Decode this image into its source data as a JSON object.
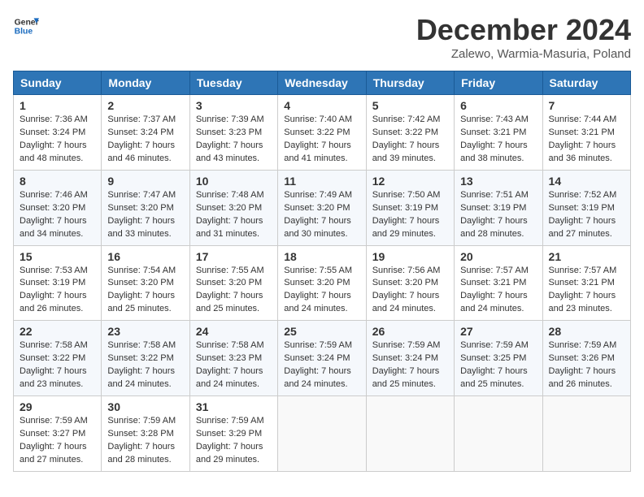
{
  "header": {
    "logo": {
      "general": "General",
      "blue": "Blue"
    },
    "title": "December 2024",
    "location": "Zalewo, Warmia-Masuria, Poland"
  },
  "weekdays": [
    "Sunday",
    "Monday",
    "Tuesday",
    "Wednesday",
    "Thursday",
    "Friday",
    "Saturday"
  ],
  "weeks": [
    [
      {
        "day": "1",
        "sunrise": "7:36 AM",
        "sunset": "3:24 PM",
        "daylight": "7 hours and 48 minutes."
      },
      {
        "day": "2",
        "sunrise": "7:37 AM",
        "sunset": "3:24 PM",
        "daylight": "7 hours and 46 minutes."
      },
      {
        "day": "3",
        "sunrise": "7:39 AM",
        "sunset": "3:23 PM",
        "daylight": "7 hours and 43 minutes."
      },
      {
        "day": "4",
        "sunrise": "7:40 AM",
        "sunset": "3:22 PM",
        "daylight": "7 hours and 41 minutes."
      },
      {
        "day": "5",
        "sunrise": "7:42 AM",
        "sunset": "3:22 PM",
        "daylight": "7 hours and 39 minutes."
      },
      {
        "day": "6",
        "sunrise": "7:43 AM",
        "sunset": "3:21 PM",
        "daylight": "7 hours and 38 minutes."
      },
      {
        "day": "7",
        "sunrise": "7:44 AM",
        "sunset": "3:21 PM",
        "daylight": "7 hours and 36 minutes."
      }
    ],
    [
      {
        "day": "8",
        "sunrise": "7:46 AM",
        "sunset": "3:20 PM",
        "daylight": "7 hours and 34 minutes."
      },
      {
        "day": "9",
        "sunrise": "7:47 AM",
        "sunset": "3:20 PM",
        "daylight": "7 hours and 33 minutes."
      },
      {
        "day": "10",
        "sunrise": "7:48 AM",
        "sunset": "3:20 PM",
        "daylight": "7 hours and 31 minutes."
      },
      {
        "day": "11",
        "sunrise": "7:49 AM",
        "sunset": "3:20 PM",
        "daylight": "7 hours and 30 minutes."
      },
      {
        "day": "12",
        "sunrise": "7:50 AM",
        "sunset": "3:19 PM",
        "daylight": "7 hours and 29 minutes."
      },
      {
        "day": "13",
        "sunrise": "7:51 AM",
        "sunset": "3:19 PM",
        "daylight": "7 hours and 28 minutes."
      },
      {
        "day": "14",
        "sunrise": "7:52 AM",
        "sunset": "3:19 PM",
        "daylight": "7 hours and 27 minutes."
      }
    ],
    [
      {
        "day": "15",
        "sunrise": "7:53 AM",
        "sunset": "3:19 PM",
        "daylight": "7 hours and 26 minutes."
      },
      {
        "day": "16",
        "sunrise": "7:54 AM",
        "sunset": "3:20 PM",
        "daylight": "7 hours and 25 minutes."
      },
      {
        "day": "17",
        "sunrise": "7:55 AM",
        "sunset": "3:20 PM",
        "daylight": "7 hours and 25 minutes."
      },
      {
        "day": "18",
        "sunrise": "7:55 AM",
        "sunset": "3:20 PM",
        "daylight": "7 hours and 24 minutes."
      },
      {
        "day": "19",
        "sunrise": "7:56 AM",
        "sunset": "3:20 PM",
        "daylight": "7 hours and 24 minutes."
      },
      {
        "day": "20",
        "sunrise": "7:57 AM",
        "sunset": "3:21 PM",
        "daylight": "7 hours and 24 minutes."
      },
      {
        "day": "21",
        "sunrise": "7:57 AM",
        "sunset": "3:21 PM",
        "daylight": "7 hours and 23 minutes."
      }
    ],
    [
      {
        "day": "22",
        "sunrise": "7:58 AM",
        "sunset": "3:22 PM",
        "daylight": "7 hours and 23 minutes."
      },
      {
        "day": "23",
        "sunrise": "7:58 AM",
        "sunset": "3:22 PM",
        "daylight": "7 hours and 24 minutes."
      },
      {
        "day": "24",
        "sunrise": "7:58 AM",
        "sunset": "3:23 PM",
        "daylight": "7 hours and 24 minutes."
      },
      {
        "day": "25",
        "sunrise": "7:59 AM",
        "sunset": "3:24 PM",
        "daylight": "7 hours and 24 minutes."
      },
      {
        "day": "26",
        "sunrise": "7:59 AM",
        "sunset": "3:24 PM",
        "daylight": "7 hours and 25 minutes."
      },
      {
        "day": "27",
        "sunrise": "7:59 AM",
        "sunset": "3:25 PM",
        "daylight": "7 hours and 25 minutes."
      },
      {
        "day": "28",
        "sunrise": "7:59 AM",
        "sunset": "3:26 PM",
        "daylight": "7 hours and 26 minutes."
      }
    ],
    [
      {
        "day": "29",
        "sunrise": "7:59 AM",
        "sunset": "3:27 PM",
        "daylight": "7 hours and 27 minutes."
      },
      {
        "day": "30",
        "sunrise": "7:59 AM",
        "sunset": "3:28 PM",
        "daylight": "7 hours and 28 minutes."
      },
      {
        "day": "31",
        "sunrise": "7:59 AM",
        "sunset": "3:29 PM",
        "daylight": "7 hours and 29 minutes."
      },
      null,
      null,
      null,
      null
    ]
  ]
}
